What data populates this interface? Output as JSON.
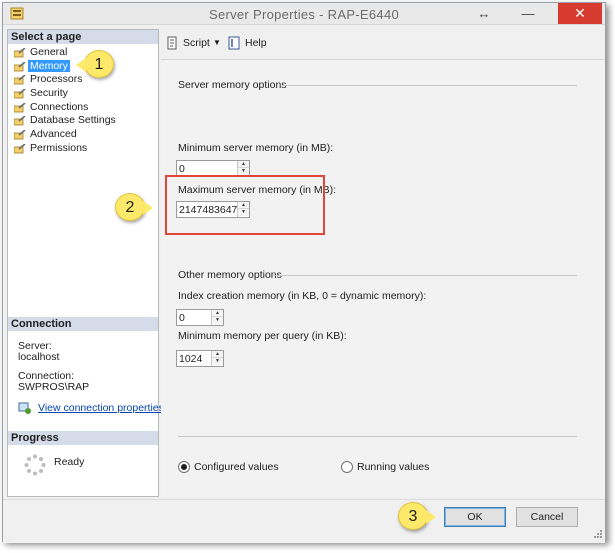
{
  "window": {
    "title": "Server Properties - RAP-E6440",
    "restore_glyph": "↔",
    "minimize_glyph": "—",
    "close_glyph": "✕"
  },
  "left_pane": {
    "select_page_header": "Select a page",
    "pages": [
      {
        "label": "General",
        "icon": "wrench-icon"
      },
      {
        "label": "Memory",
        "icon": "wrench-icon",
        "selected": true
      },
      {
        "label": "Processors",
        "icon": "wrench-icon"
      },
      {
        "label": "Security",
        "icon": "wrench-icon"
      },
      {
        "label": "Connections",
        "icon": "wrench-icon"
      },
      {
        "label": "Database Settings",
        "icon": "wrench-icon"
      },
      {
        "label": "Advanced",
        "icon": "wrench-icon"
      },
      {
        "label": "Permissions",
        "icon": "wrench-icon"
      }
    ],
    "connection_header": "Connection",
    "server_label": "Server:",
    "server_value": "localhost",
    "connection_label": "Connection:",
    "connection_value": "SWPROS\\RAP",
    "view_connection_link": "View connection properties",
    "progress_header": "Progress",
    "progress_status": "Ready"
  },
  "toolbar": {
    "script_label": "Script",
    "help_label": "Help"
  },
  "memory": {
    "server_memory_options_title": "Server memory options",
    "min_server_memory_label": "Minimum server memory (in MB):",
    "min_server_memory_value": "0",
    "max_server_memory_label": "Maximum server memory (in MB):",
    "max_server_memory_value": "2147483647",
    "other_memory_options_title": "Other memory options",
    "index_creation_memory_label": "Index creation memory (in KB, 0 = dynamic memory):",
    "index_creation_memory_value": "0",
    "min_memory_per_query_label": "Minimum memory per query (in KB):",
    "min_memory_per_query_value": "1024",
    "configured_values_label": "Configured values",
    "running_values_label": "Running values",
    "selected_values_mode": "Configured values"
  },
  "buttons": {
    "ok_label": "OK",
    "cancel_label": "Cancel"
  },
  "callouts": {
    "one": "1",
    "two": "2",
    "three": "3"
  },
  "colors": {
    "selection_blue": "#3399ff",
    "highlight_red": "#e0463a",
    "callout_yellow": "#fce96a",
    "close_red": "#d73a2f"
  }
}
